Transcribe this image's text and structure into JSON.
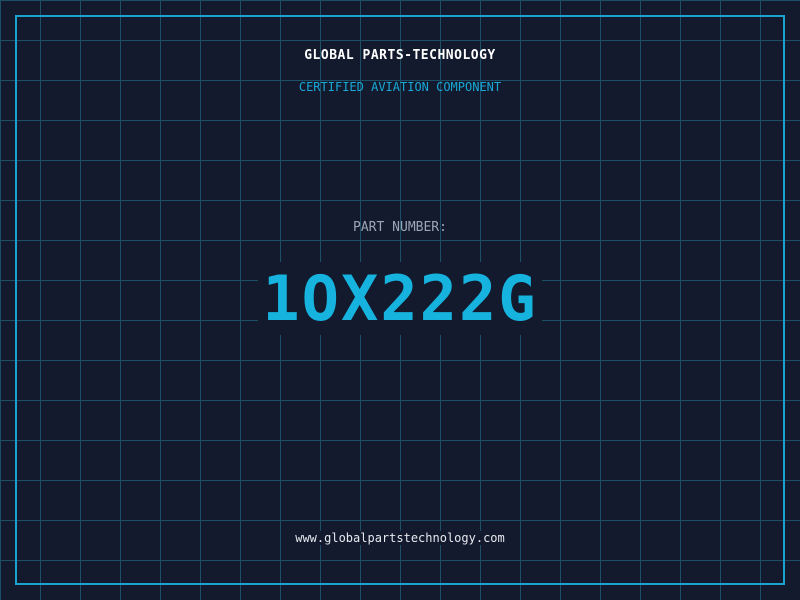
{
  "company": "GLOBAL PARTS-TECHNOLOGY",
  "subtitle": "CERTIFIED AVIATION COMPONENT",
  "part": {
    "label": "PART NUMBER:",
    "number": "1OX222G"
  },
  "website": "www.globalpartstechnology.com",
  "colors": {
    "background": "#131a2d",
    "grid": "#1d4f66",
    "accent": "#16b3df",
    "frame": "#1aa3cf"
  }
}
